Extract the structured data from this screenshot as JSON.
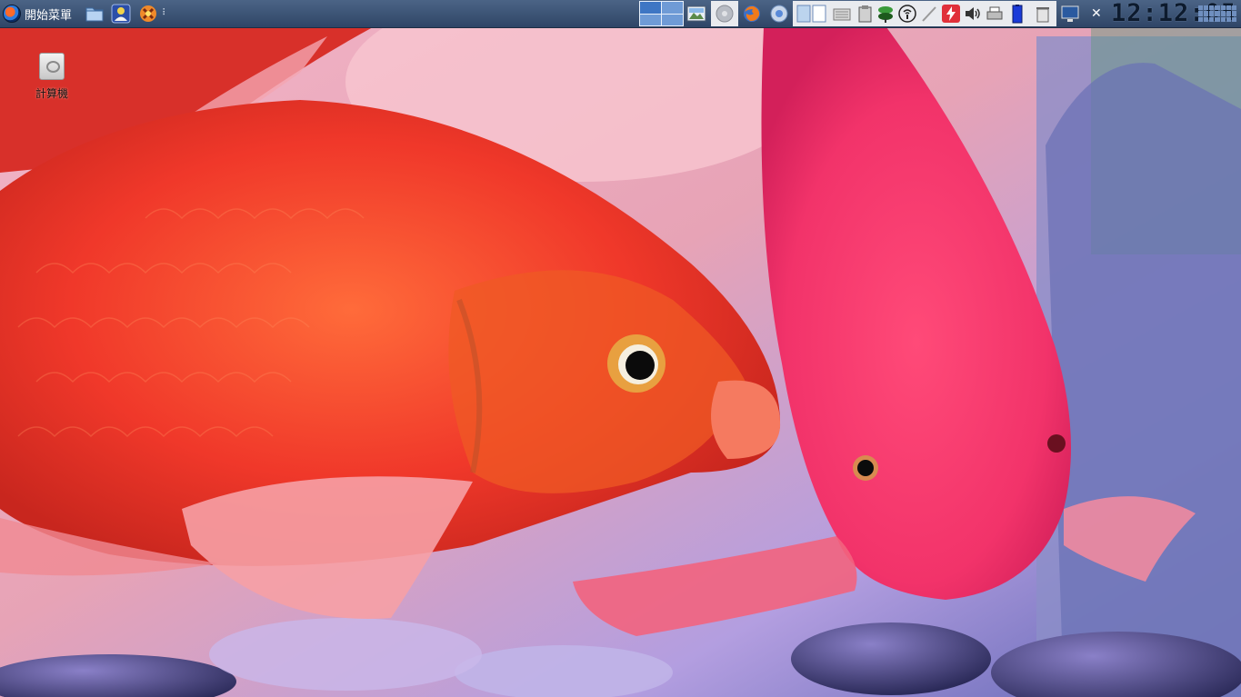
{
  "taskbar": {
    "start_label": "開始菜單",
    "quick_launch": [
      {
        "name": "file-manager",
        "icon": "folder-icon"
      },
      {
        "name": "user-manager",
        "icon": "user-icon"
      },
      {
        "name": "applications",
        "icon": "apps-icon"
      }
    ],
    "more_glyph": "⠇",
    "pager": {
      "desktops": 4,
      "active": 1
    },
    "tray_icons": [
      "image-viewer-icon",
      "disc-icon",
      "firefox-icon",
      "browser-icon",
      "window-split-icon",
      "keyboard-icon",
      "clipboard-icon",
      "network-icon",
      "wireless-icon",
      "pen-icon",
      "power-icon",
      "volume-icon",
      "printer-icon",
      "battery-icon",
      "trash-icon",
      "monitor-icon"
    ],
    "close_glyph": "✕",
    "clock": "12:12:05"
  },
  "desktop": {
    "icons": [
      {
        "label": "計算機",
        "icon": "computer-icon"
      }
    ]
  },
  "colors": {
    "taskbar_top": "#4b6486",
    "taskbar_bottom": "#2f4566",
    "fish_red": "#f23a2a",
    "fish_pink": "#f0356a",
    "water": "#a58fd6"
  }
}
